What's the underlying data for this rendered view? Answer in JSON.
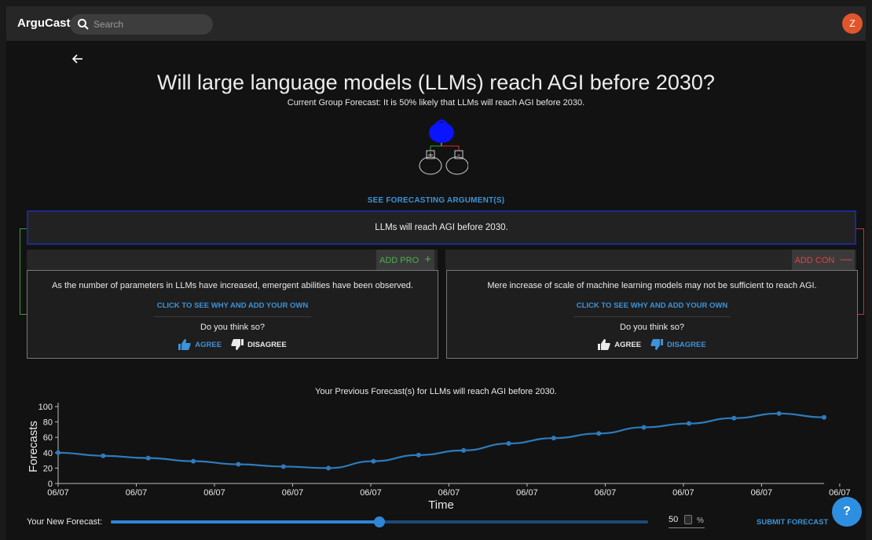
{
  "appbar": {
    "brand": "ArguCast",
    "search_placeholder": "Search",
    "avatar_initial": "Z"
  },
  "question": {
    "title": "Will large language models (LLMs) reach AGI before 2030?",
    "group_forecast": "Current Group Forecast: It is 50% likely that LLMs will reach AGI before 2030."
  },
  "tree": {
    "pro_symbol": "+",
    "con_symbol": "-"
  },
  "see_arguments_label": "SEE FORECASTING ARGUMENT(S)",
  "main_claim": "LLMs will reach AGI before 2030.",
  "pro": {
    "add_label": "ADD PRO",
    "card": {
      "text": "As the number of parameters in LLMs have increased, emergent abilities have been observed.",
      "link": "CLICK TO SEE WHY AND ADD YOUR OWN",
      "question": "Do you think so?",
      "agree": "AGREE",
      "disagree": "DISAGREE",
      "selected": "agree"
    }
  },
  "con": {
    "add_label": "ADD CON",
    "card": {
      "text": "Mere increase of scale of machine learning models may not be sufficient to reach AGI.",
      "link": "CLICK TO SEE WHY AND ADD YOUR OWN",
      "question": "Do you think so?",
      "agree": "AGREE",
      "disagree": "DISAGREE",
      "selected": "disagree"
    }
  },
  "colors": {
    "accent": "#3c93d8",
    "pro": "#4caf50",
    "con": "#e04444",
    "claim_border": "#1b2a8f",
    "line": "#2e7bbd"
  },
  "chart_data": {
    "type": "line",
    "title": "Your Previous Forecast(s) for LLMs will reach AGI before 2030.",
    "xlabel": "Time",
    "ylabel": "Forecasts",
    "ylim": [
      0,
      100
    ],
    "yticks": [
      0,
      20,
      40,
      60,
      80,
      100
    ],
    "xtick_labels": [
      "06/07",
      "06/07",
      "06/07",
      "06/07",
      "06/07",
      "06/07",
      "06/07",
      "06/07",
      "06/07",
      "06/07",
      "06/07"
    ],
    "grid": false,
    "series": [
      {
        "values": [
          40,
          36,
          33,
          29,
          25,
          22,
          20,
          29,
          37,
          43,
          52,
          59,
          65,
          73,
          78,
          85,
          91,
          86
        ]
      }
    ]
  },
  "forecast": {
    "label": "Your New Forecast:",
    "value": 50,
    "value_text": "50",
    "unit": "%",
    "submit_label": "SUBMIT FORECAST"
  },
  "help_label": "?"
}
